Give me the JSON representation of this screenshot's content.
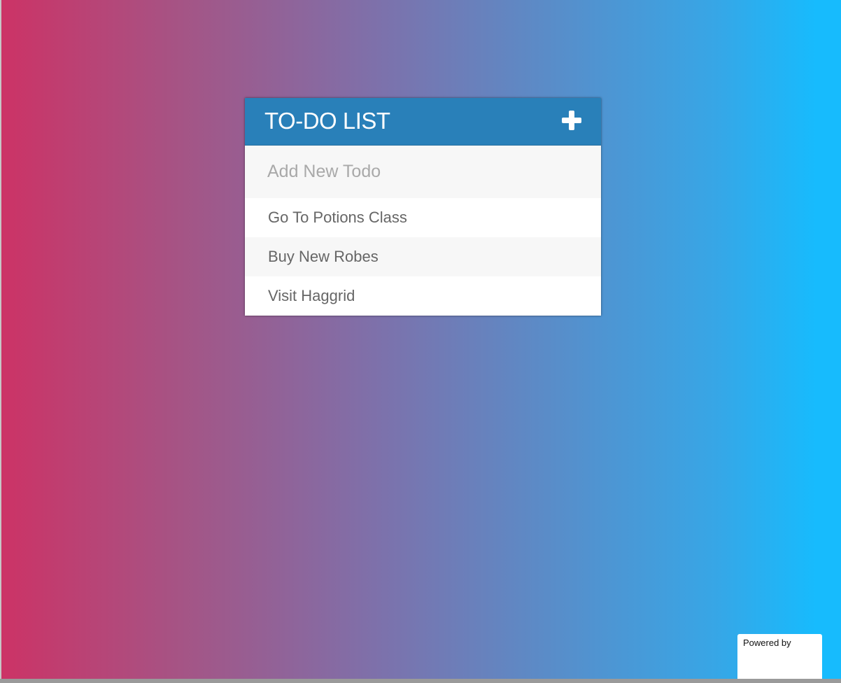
{
  "todo_card": {
    "title": "TO-DO LIST",
    "add_button_icon": "plus-icon",
    "new_todo": {
      "value": "",
      "placeholder": "Add New Todo"
    },
    "items": [
      {
        "text": "Go To Potions Class"
      },
      {
        "text": "Buy New Robes"
      },
      {
        "text": "Visit Haggrid"
      }
    ]
  },
  "powered_by": {
    "label": "Powered by"
  },
  "colors": {
    "header": "#2980b9",
    "gradient_start": "#cc3366",
    "gradient_end": "#17bbfd",
    "text": "#666666",
    "row_alt": "#f7f7f7"
  }
}
